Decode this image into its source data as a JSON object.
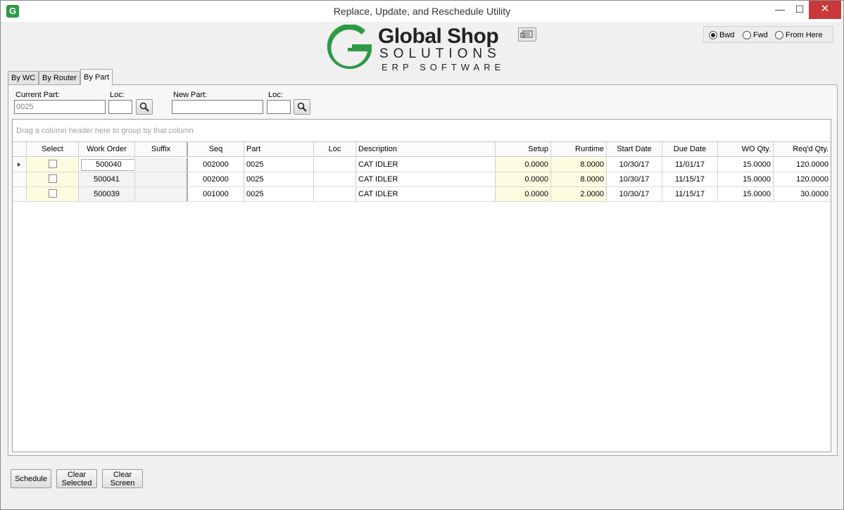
{
  "window": {
    "title": "Replace, Update, and Reschedule Utility",
    "icon_letter": "G",
    "minimize": "—",
    "maximize": "☐",
    "close": "✕"
  },
  "logo": {
    "line1": "Global Shop",
    "line2": "SOLUTIONS",
    "line3": "ERP SOFTWARE",
    "brand_color": "#2e9a45"
  },
  "schedule_mode": {
    "options": [
      {
        "label": "Bwd",
        "selected": true
      },
      {
        "label": "Fwd",
        "selected": false
      },
      {
        "label": "From Here",
        "selected": false
      }
    ]
  },
  "tabs": [
    {
      "label": "By WC",
      "active": false
    },
    {
      "label": "By Router",
      "active": false
    },
    {
      "label": "By Part",
      "active": true
    }
  ],
  "form": {
    "current_part_label": "Current Part:",
    "current_part_value": "0025",
    "loc_label": "Loc:",
    "current_loc_value": "",
    "new_part_label": "New Part:",
    "new_part_value": "",
    "new_loc_label": "Loc:",
    "new_loc_value": ""
  },
  "grid": {
    "group_hint": "Drag a column header here to group by that column",
    "columns": [
      "Select",
      "Work Order",
      "Suffix",
      "Seq",
      "Part",
      "Loc",
      "Description",
      "Setup",
      "Runtime",
      "Start Date",
      "Due Date",
      "WO Qty.",
      "Req'd Qty."
    ],
    "rows": [
      [
        "",
        "500040",
        "",
        "002000",
        "0025",
        "",
        "CAT IDLER",
        "0.0000",
        "8.0000",
        "10/30/17",
        "11/01/17",
        "15.0000",
        "120.0000"
      ],
      [
        "",
        "500041",
        "",
        "002000",
        "0025",
        "",
        "CAT IDLER",
        "0.0000",
        "8.0000",
        "10/30/17",
        "11/15/17",
        "15.0000",
        "120.0000"
      ],
      [
        "",
        "500039",
        "",
        "001000",
        "0025",
        "",
        "CAT IDLER",
        "0.0000",
        "2.0000",
        "10/30/17",
        "11/15/17",
        "15.0000",
        "30.0000"
      ]
    ]
  },
  "buttons": {
    "schedule": "Schedule",
    "clear_selected": "Clear\nSelected",
    "clear_screen": "Clear\nScreen"
  }
}
